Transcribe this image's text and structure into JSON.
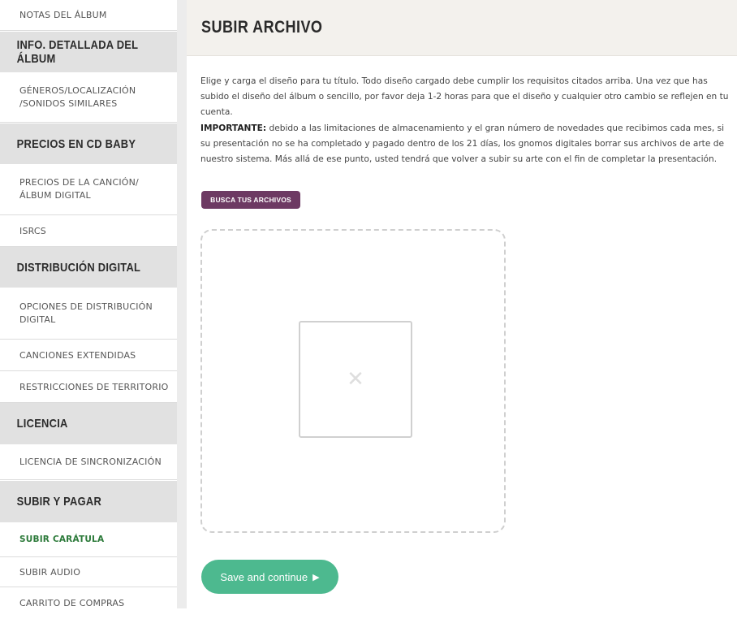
{
  "sidebar": {
    "items": [
      {
        "type": "link",
        "label": "NOTAS DEL ÁLBUM"
      },
      {
        "type": "header",
        "label": "INFO. DETALLADA DEL ÁLBUM"
      },
      {
        "type": "link",
        "label": "GÉNEROS/LOCALIZACIÓN /SONIDOS SIMILARES"
      },
      {
        "type": "header",
        "label": "PRECIOS EN CD BABY"
      },
      {
        "type": "link",
        "label": "PRECIOS DE LA CANCIÓN/ÁLBUM DIGITAL"
      },
      {
        "type": "link",
        "label": "ISRCS"
      },
      {
        "type": "header",
        "label": "DISTRIBUCIÓN DIGITAL"
      },
      {
        "type": "link",
        "label": "OPCIONES DE DISTRIBUCIÓN DIGITAL"
      },
      {
        "type": "link",
        "label": "CANCIONES EXTENDIDAS"
      },
      {
        "type": "link",
        "label": "RESTRICCIONES DE TERRITORIO"
      },
      {
        "type": "header",
        "label": "LICENCIA"
      },
      {
        "type": "link",
        "label": "LICENCIA DE SINCRONIZACIÓN"
      },
      {
        "type": "header",
        "label": "SUBIR Y PAGAR"
      },
      {
        "type": "link",
        "label": "SUBIR CARÁTULA",
        "active": true
      },
      {
        "type": "link",
        "label": "SUBIR AUDIO"
      },
      {
        "type": "link",
        "label": "CARRITO DE COMPRAS"
      }
    ]
  },
  "main": {
    "title": "SUBIR ARCHIVO",
    "paragraph1": "Elige y carga el diseño para tu título. Todo diseño cargado debe cumplir los requisitos citados arriba. Una vez que has subido el diseño del álbum o sencillo, por favor deja 1-2 horas para que el diseño y cualquier otro cambio se reflejen en tu cuenta.",
    "important_label": "IMPORTANTE:",
    "paragraph2": "debido a las limitaciones de almacenamiento y el gran número de novedades que recibimos cada mes, si su presentación no se ha completado y pagado dentro de los 21 días, los gnomos digitales borrar sus archivos de arte de nuestro sistema. Más allá de ese punto, usted tendrá que volver a subir su arte con el fin de completar la presentación.",
    "browse_button": "BUSCA TUS ARCHIVOS",
    "save_button": "Save and continue",
    "icons": {
      "placeholder": "broken-image-icon",
      "save_arrow": "play-arrow-icon"
    },
    "colors": {
      "browse": "#6d3a63",
      "save": "#4db98f",
      "active_link": "#2c7a3a"
    }
  }
}
